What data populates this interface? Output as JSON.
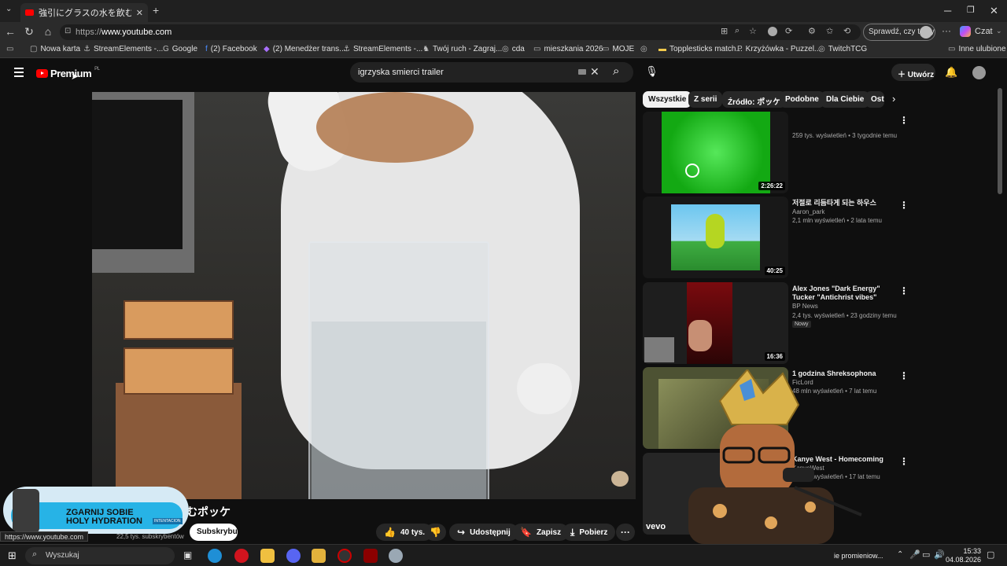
{
  "browser": {
    "tab_title": "強引にグラスの水を飲むポッケ - YouTube",
    "url_prefix": "https://",
    "url_host": "www.youtube.com",
    "check_button": "Sprawdź, czy to Ty",
    "copilot_label": "Czat",
    "bookmarks": [
      "Nowa karta",
      "StreamElements -...",
      "Google",
      "(2) Facebook",
      "(2) Menedżer trans...",
      "StreamElements -...",
      "Twój ruch - Zagraj...",
      "cda",
      "mieszkania 2026",
      "MOJE",
      "Topplesticks match...",
      "Krzyżówka - Puzzel...",
      "TwitchTCG"
    ],
    "other_bookmarks": "Inne ulubione"
  },
  "youtube": {
    "logo": "Premium",
    "logo_region": "PL",
    "search_query": "igrzyska smierci trailer",
    "create_label": "Utwórz",
    "chips": [
      "Wszystkie",
      "Z serii",
      "Źródło: ポッケ",
      "Podobne",
      "Dla Ciebie",
      "Ost"
    ],
    "video_title": "むポッケ",
    "subscribe_label": "Subskrybuj",
    "subscriber_count": "22,5 tys. subskrybentów",
    "like_count": "40 tys.",
    "share_label": "Udostępnij",
    "save_label": "Zapisz",
    "download_label": "Pobierz",
    "status_url": "https://www.youtube.com",
    "promo": {
      "headline": "ZGARNIJ SOBIE HOLY HYDRATION",
      "tag": "INTENTACION"
    }
  },
  "recommendations": [
    {
      "title": "",
      "channel": "",
      "meta": "259 tys. wyświetleń • 3 tygodnie temu",
      "duration": "2:26:22",
      "thumb_color": "#1fbf1f"
    },
    {
      "title": "저절로 리듬타게 되는 하우스",
      "channel": "Aaron_park",
      "meta": "2,1 mln wyświetleń • 2 lata temu",
      "duration": "40:25",
      "thumb_color": "#5cb8e6"
    },
    {
      "title": "Alex Jones \"Dark Energy\" Tucker \"Antichrist vibes\" Marjorie Taylor ...",
      "channel": "BP News",
      "meta": "2,4 tys. wyświetleń • 23 godziny temu",
      "badge": "Nowy",
      "duration": "16:36",
      "thumb_color": "#8b0f12"
    },
    {
      "title": "1 godzina Shreksophona",
      "channel": "FicLord",
      "meta": "48 mln wyświetleń • 7 lat temu",
      "duration": "",
      "thumb_color": "#6b7a3a"
    },
    {
      "title": "Kanye West - Homecoming",
      "channel": "KanyeWest",
      "meta": "34 mln wyświetleń • 17 lat temu",
      "duration": "",
      "thumb_color": "#2a2a2a",
      "brand": "vevo"
    }
  ],
  "taskbar": {
    "search_placeholder": "Wyszukaj",
    "time": "15:33",
    "date": "04.08.2026",
    "running_window": "ie promieniow..."
  }
}
